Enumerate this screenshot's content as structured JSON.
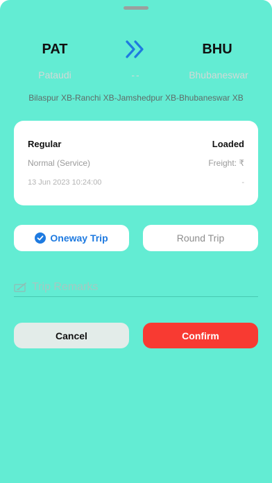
{
  "route": {
    "from_code": "PAT",
    "to_code": "BHU",
    "from_name": "Pataudi",
    "to_name": "Bhubaneswar",
    "separator": "--",
    "via": "Bilaspur XB-Ranchi XB-Jamshedpur XB-Bhubaneswar XB"
  },
  "details": {
    "trip_type": "Regular",
    "load_status": "Loaded",
    "service": "Normal (Service)",
    "freight_label": "Freight: ₹",
    "datetime": "13 Jun 2023 10:24:00",
    "datetime_right": "-"
  },
  "trip_options": {
    "oneway_label": "Oneway Trip",
    "round_label": "Round Trip",
    "selected": "oneway"
  },
  "remarks": {
    "placeholder": "Trip Remarks",
    "value": ""
  },
  "actions": {
    "cancel_label": "Cancel",
    "confirm_label": "Confirm"
  },
  "colors": {
    "sheet_background": "#63ecd3",
    "accent_blue": "#1e7ae0",
    "confirm_red": "#f83a32"
  },
  "icons": {
    "direction": "double-chevron-right-icon",
    "selected_check": "check-circle-icon",
    "remarks": "pen-icon"
  }
}
